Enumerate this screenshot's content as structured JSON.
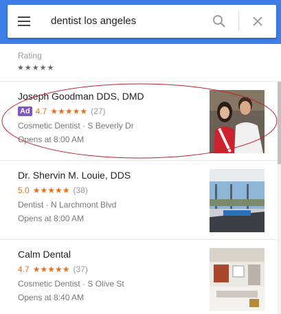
{
  "search": {
    "query": "dentist los angeles"
  },
  "icons": {
    "menu": "menu-icon",
    "search": "search-icon",
    "close": "close-icon"
  },
  "filters": {
    "rating_label": "Rating",
    "rating_stars": "★★★★★"
  },
  "results": [
    {
      "name": "Joseph Goodman DDS, DMD",
      "ad": "Ad",
      "rating": "4.7",
      "stars": "★★★★★",
      "reviews": "(27)",
      "meta": "Cosmetic Dentist · S Beverly Dr",
      "hours": "Opens at 8:00 AM"
    },
    {
      "name": "Dr. Shervin M. Louie, DDS",
      "rating": "5.0",
      "stars": "★★★★★",
      "reviews": "(38)",
      "meta": "Dentist · N Larchmont Blvd",
      "hours": "Opens at 8:00 AM"
    },
    {
      "name": "Calm Dental",
      "rating": "4.7",
      "stars": "★★★★★",
      "reviews": "(37)",
      "meta": "Cosmetic Dentist · S Olive St",
      "hours": "Opens at 8:40 AM"
    }
  ],
  "colors": {
    "header": "#3d7ee6",
    "rating": "#e7711b",
    "ad_badge": "#7e57c2",
    "annotation": "#c0202a"
  }
}
